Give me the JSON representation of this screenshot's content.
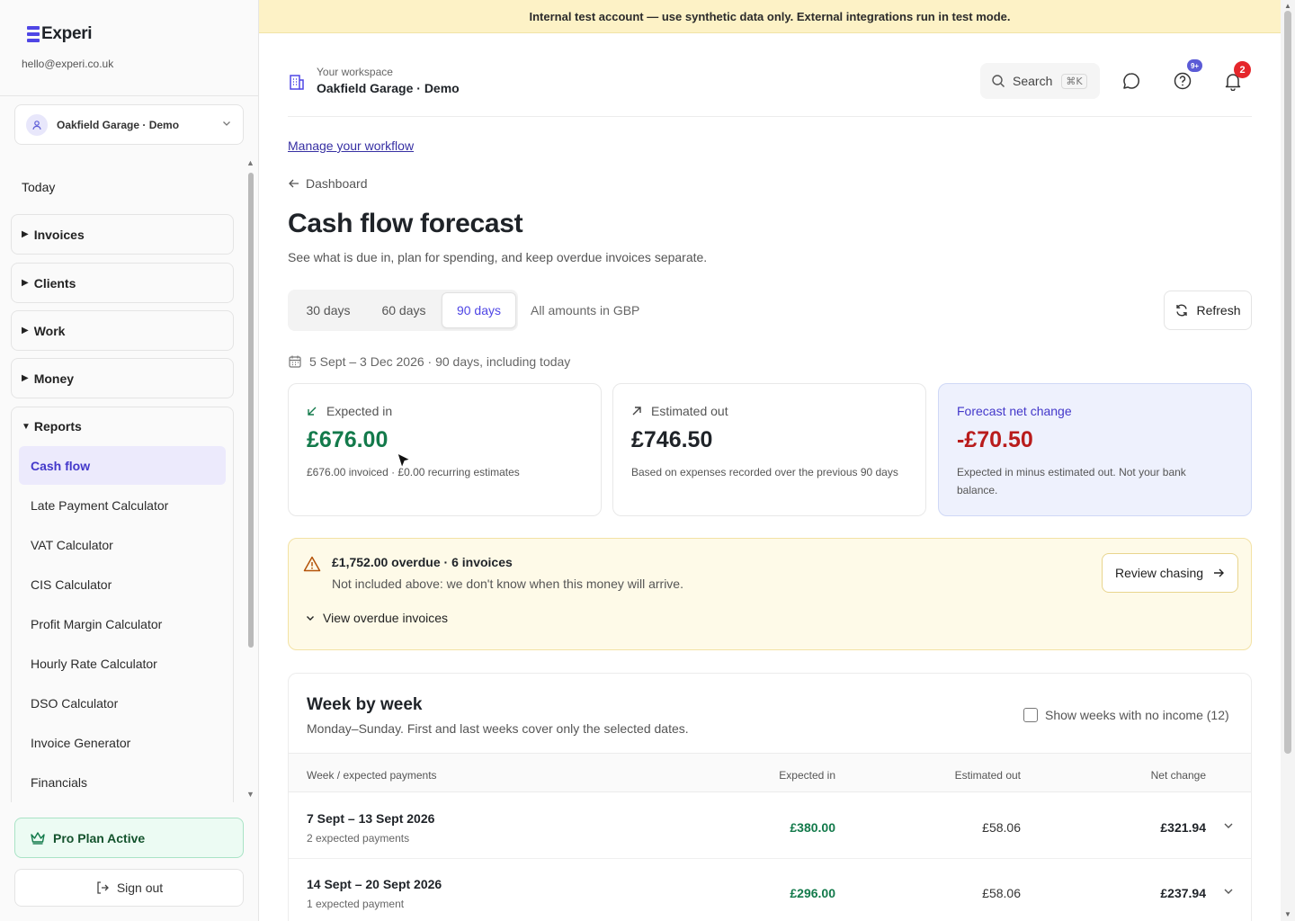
{
  "sidebar": {
    "brand": "Experi",
    "email": "hello@experi.co.uk",
    "workspace_select": "Oakfield Garage · Demo",
    "today": "Today",
    "groups": [
      "Invoices",
      "Clients",
      "Work",
      "Money"
    ],
    "reports_label": "Reports",
    "report_items": [
      "Cash flow",
      "Late Payment Calculator",
      "VAT Calculator",
      "CIS Calculator",
      "Profit Margin Calculator",
      "Hourly Rate Calculator",
      "DSO Calculator",
      "Invoice Generator",
      "Financials"
    ],
    "pro_plan": "Pro Plan Active",
    "sign_out": "Sign out"
  },
  "banner": "Internal test account — use synthetic data only. External integrations run in test mode.",
  "header": {
    "workspace_label": "Your workspace",
    "workspace_name": "Oakfield Garage · Demo",
    "search_label": "Search",
    "search_shortcut": "⌘K",
    "help_badge": "9+",
    "notification_badge": "2"
  },
  "page": {
    "workflow_link": "Manage your workflow",
    "back_link": "Dashboard",
    "title": "Cash flow forecast",
    "subtitle": "See what is due in, plan for spending, and keep overdue invoices separate.",
    "range_tabs": [
      "30 days",
      "60 days",
      "90 days"
    ],
    "active_range": "90 days",
    "currency_note": "All amounts in GBP",
    "refresh_label": "Refresh",
    "date_range": "5 Sept – 3 Dec 2026 · 90 days, including today"
  },
  "cards": {
    "expected_in": {
      "label": "Expected in",
      "value": "£676.00",
      "note": "£676.00 invoiced · £0.00 recurring estimates"
    },
    "estimated_out": {
      "label": "Estimated out",
      "value": "£746.50",
      "note": "Based on expenses recorded over the previous 90 days"
    },
    "net_change": {
      "label": "Forecast net change",
      "value": "-£70.50",
      "note": "Expected in minus estimated out. Not your bank balance."
    }
  },
  "overdue": {
    "title": "£1,752.00 overdue · 6 invoices",
    "subtitle": "Not included above: we don't know when this money will arrive.",
    "view_label": "View overdue invoices",
    "review_label": "Review chasing"
  },
  "weekly": {
    "title": "Week by week",
    "subtitle": "Monday–Sunday. First and last weeks cover only the selected dates.",
    "toggle_label": "Show weeks with no income (12)",
    "columns": [
      "Week / expected payments",
      "Expected in",
      "Estimated out",
      "Net change"
    ],
    "rows": [
      {
        "week": "7 Sept – 13 Sept 2026",
        "payments": "2 expected payments",
        "expected_in": "£380.00",
        "estimated_out": "£58.06",
        "net_change": "£321.94"
      },
      {
        "week": "14 Sept – 20 Sept 2026",
        "payments": "1 expected payment",
        "expected_in": "£296.00",
        "estimated_out": "£58.06",
        "net_change": "£237.94"
      }
    ]
  },
  "colors": {
    "accent": "#4f46e5",
    "positive": "#137a4b",
    "negative": "#b91c1c",
    "banner": "#fdf2c6",
    "warning_bg": "#fefae8"
  }
}
